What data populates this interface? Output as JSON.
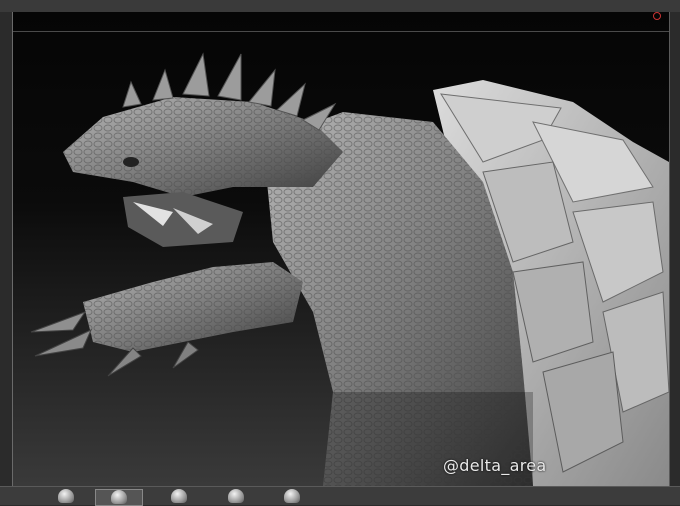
{
  "watermark": "@delta_area",
  "shelf_brushes": [
    "brush-1",
    "brush-2",
    "brush-3",
    "brush-4",
    "brush-5"
  ]
}
